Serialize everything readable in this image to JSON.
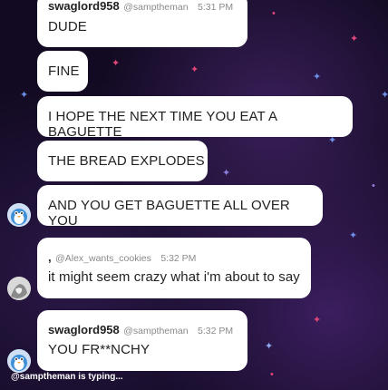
{
  "messages": [
    {
      "user": "swaglord958",
      "handle": "@samptheman",
      "time": "5:31 PM",
      "text": "DUDE"
    },
    {
      "text": "FINE"
    },
    {
      "text": "I HOPE THE NEXT TIME YOU EAT A BAGUETTE"
    },
    {
      "text": "THE BREAD EXPLODES"
    },
    {
      "text": "AND YOU GET BAGUETTE ALL OVER YOU"
    },
    {
      "user": ",",
      "handle": "@Alex_wants_cookies",
      "time": "5:32 PM",
      "text": "it might seem crazy what i'm about to say"
    },
    {
      "user": "swaglord958",
      "handle": "@samptheman",
      "time": "5:32 PM",
      "text": "YOU FR**NCHY"
    }
  ],
  "typing_indicator": "@samptheman is typing...",
  "colors": {
    "background": "#120a22",
    "bubble": "#ffffff",
    "star_pink": "#e0457a",
    "star_blue": "#6d8fe8"
  }
}
